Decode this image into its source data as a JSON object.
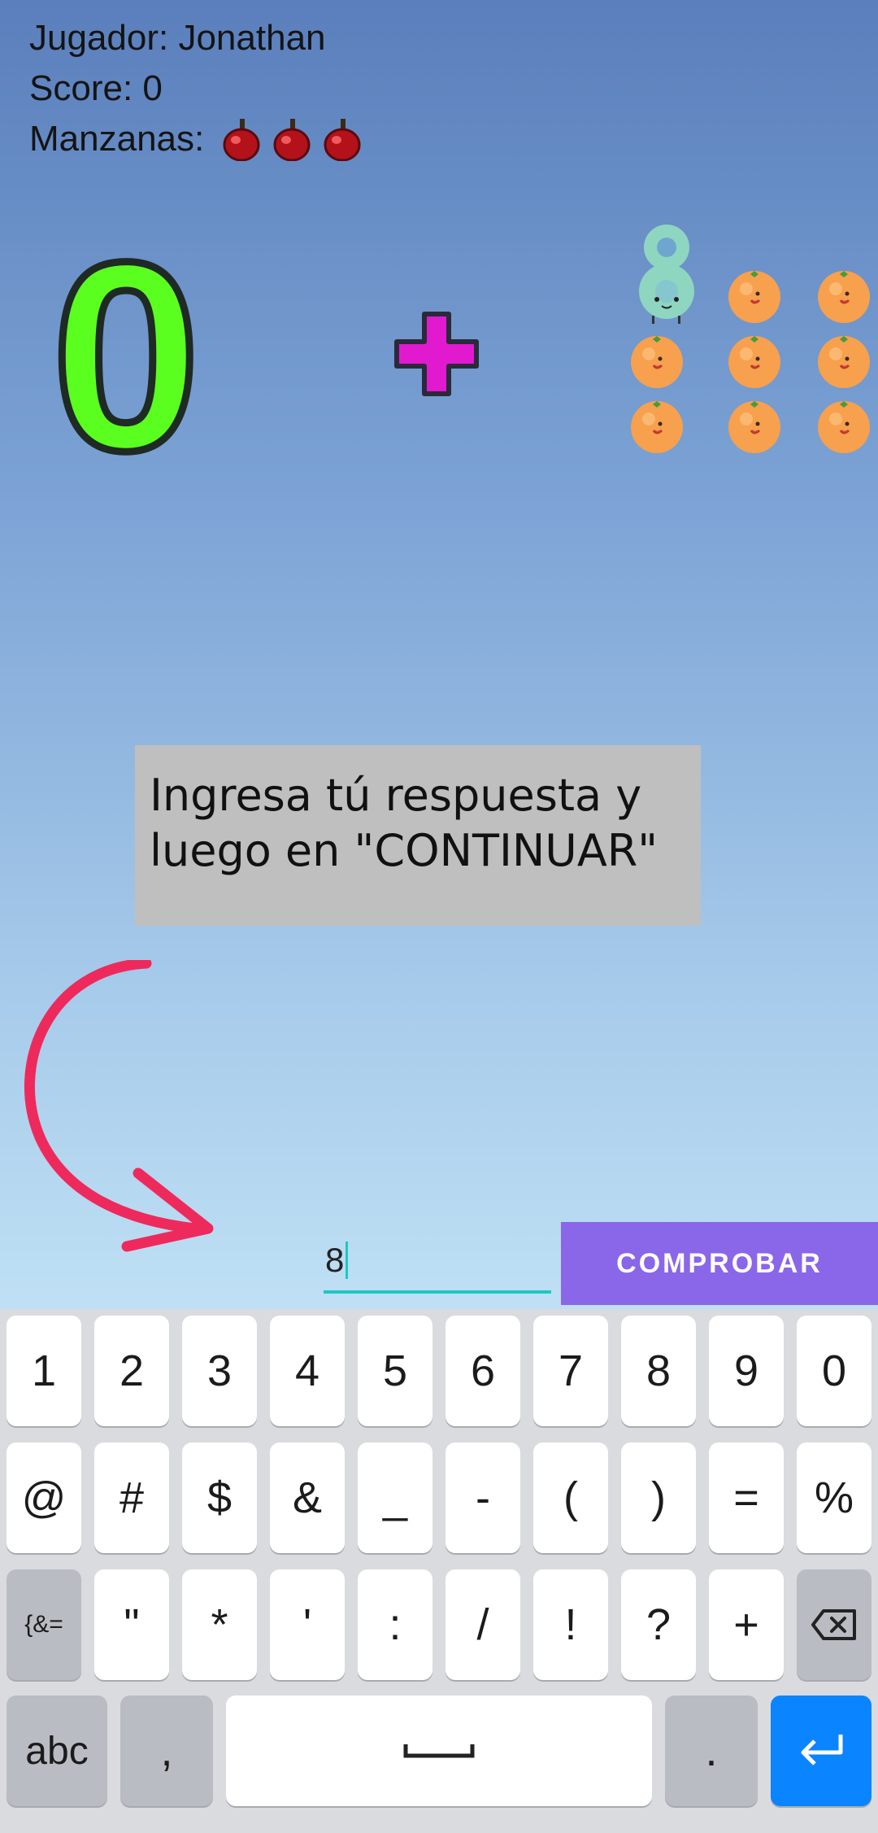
{
  "hud": {
    "player": "Jugador: Jonathan",
    "score": "Score: 0",
    "apples_label": "Manzanas:",
    "apples_count": 3
  },
  "problem": {
    "left_operand": "0",
    "operator": "+",
    "right_operand": "8",
    "right_oranges": 8
  },
  "hint": "Ingresa tú respuesta y\nluego en \"CONTINUAR\"",
  "answer": {
    "value": "8"
  },
  "check_button": {
    "label": "COMPROBAR"
  },
  "colors": {
    "operand_green": "#5bff1f",
    "operator_magenta": "#e11ad0",
    "arrow_pink": "#ee2a5c",
    "button_purple": "#8a66e8",
    "field_teal": "#1fc7c2",
    "enter_blue": "#0a84ff"
  },
  "keyboard": {
    "row1": [
      "1",
      "2",
      "3",
      "4",
      "5",
      "6",
      "7",
      "8",
      "9",
      "0"
    ],
    "row2": [
      "@",
      "#",
      "$",
      "&",
      "_",
      "-",
      "(",
      ")",
      "=",
      "%"
    ],
    "row3": [
      "{&=",
      "\"",
      "*",
      "'",
      ":",
      "/",
      "!",
      "?",
      "+"
    ],
    "abc": "abc",
    "comma": ",",
    "period": ".",
    "icons": {
      "backspace": "backspace-icon",
      "space": "space-bar-icon",
      "enter": "enter-icon"
    }
  }
}
